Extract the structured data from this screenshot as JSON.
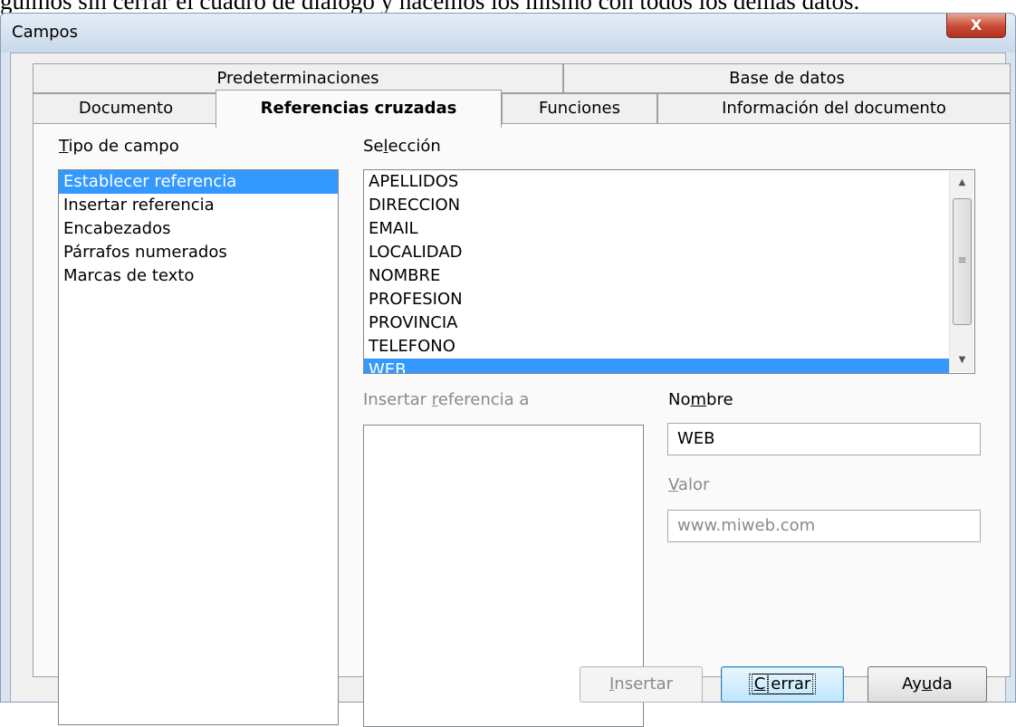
{
  "background_text": "guimos sin cerrar el cuadro de diálogo y hacemos los mismo con todos los demás datos.",
  "window": {
    "title": "Campos",
    "close_label": "X"
  },
  "tabs_row1": [
    {
      "label": "Predeterminaciones"
    },
    {
      "label": "Base de datos"
    }
  ],
  "tabs_row2": [
    {
      "label": "Documento"
    },
    {
      "label": "Referencias cruzadas",
      "active": true
    },
    {
      "label": "Funciones"
    },
    {
      "label": "Información del documento"
    }
  ],
  "tipo_campo": {
    "label_first": "T",
    "label_rest": "ipo de campo",
    "items": [
      {
        "label": "Establecer referencia",
        "selected": true
      },
      {
        "label": "Insertar referencia"
      },
      {
        "label": "Encabezados"
      },
      {
        "label": "Párrafos numerados"
      },
      {
        "label": "Marcas de texto"
      }
    ]
  },
  "seleccion": {
    "label_a": "Se",
    "label_u": "l",
    "label_b": "ección",
    "items": [
      {
        "label": "APELLIDOS"
      },
      {
        "label": "DIRECCION"
      },
      {
        "label": "EMAIL"
      },
      {
        "label": "LOCALIDAD"
      },
      {
        "label": "NOMBRE"
      },
      {
        "label": "PROFESION"
      },
      {
        "label": "PROVINCIA"
      },
      {
        "label": "TELEFONO"
      },
      {
        "label": "WEB",
        "selected": true
      }
    ]
  },
  "insertar_ref": {
    "label_a": "Insertar ",
    "label_u": "r",
    "label_b": "eferencia a"
  },
  "nombre": {
    "label_a": "No",
    "label_u": "m",
    "label_b": "bre",
    "value": "WEB"
  },
  "valor": {
    "label_u": "V",
    "label_b": "alor",
    "value": "www.miweb.com"
  },
  "buttons": {
    "insertar": {
      "u": "I",
      "rest": "nsertar"
    },
    "cerrar": {
      "u": "C",
      "rest": "errar"
    },
    "ayuda": {
      "a": "Ay",
      "u": "u",
      "b": "da"
    }
  }
}
